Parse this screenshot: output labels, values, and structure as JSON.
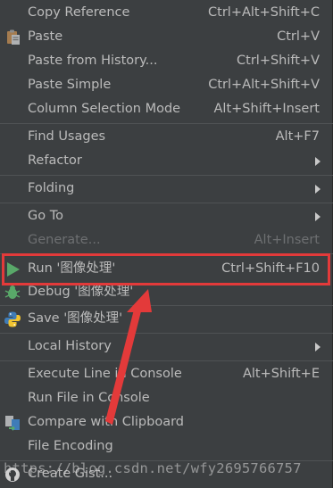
{
  "menu": {
    "copy_reference": {
      "label": "Copy Reference",
      "shortcut": "Ctrl+Alt+Shift+C"
    },
    "paste": {
      "label": "Paste",
      "shortcut": "Ctrl+V",
      "icon": "clipboard-paste-icon"
    },
    "paste_from_history": {
      "label": "Paste from History...",
      "shortcut": "Ctrl+Shift+V"
    },
    "paste_simple": {
      "label": "Paste Simple",
      "shortcut": "Ctrl+Alt+Shift+V"
    },
    "column_selection_mode": {
      "label": "Column Selection Mode",
      "shortcut": "Alt+Shift+Insert"
    },
    "find_usages": {
      "label": "Find Usages",
      "shortcut": "Alt+F7"
    },
    "refactor": {
      "label": "Refactor",
      "submenu": true
    },
    "folding": {
      "label": "Folding",
      "submenu": true
    },
    "go_to": {
      "label": "Go To",
      "submenu": true
    },
    "generate": {
      "label": "Generate...",
      "shortcut": "Alt+Insert",
      "disabled": true
    },
    "run": {
      "label": "Run '图像处理'",
      "shortcut": "Ctrl+Shift+F10",
      "icon": "run-triangle-icon",
      "highlighted": true
    },
    "debug": {
      "label": "Debug '图像处理'",
      "icon": "debug-bug-icon"
    },
    "save": {
      "label": "Save '图像处理'",
      "icon": "python-icon"
    },
    "local_history": {
      "label": "Local History",
      "submenu": true
    },
    "execute_line": {
      "label": "Execute Line in Console",
      "shortcut": "Alt+Shift+E"
    },
    "run_file_console": {
      "label": "Run File in Console"
    },
    "compare_clipboard": {
      "label": "Compare with Clipboard",
      "icon": "compare-icon"
    },
    "file_encoding": {
      "label": "File Encoding"
    },
    "create_gist": {
      "label": "Create Gist...",
      "icon": "github-icon"
    }
  },
  "watermark": "https://blog.csdn.net/wfy2695766757",
  "colors": {
    "background": "#3c3f41",
    "text": "#bbbbbb",
    "disabled": "#6d6f71",
    "separator": "#4f5254",
    "annotation": "#e33a3a",
    "run_green": "#59a869",
    "python_blue": "#3f7cb8",
    "python_yellow": "#f0c330"
  }
}
